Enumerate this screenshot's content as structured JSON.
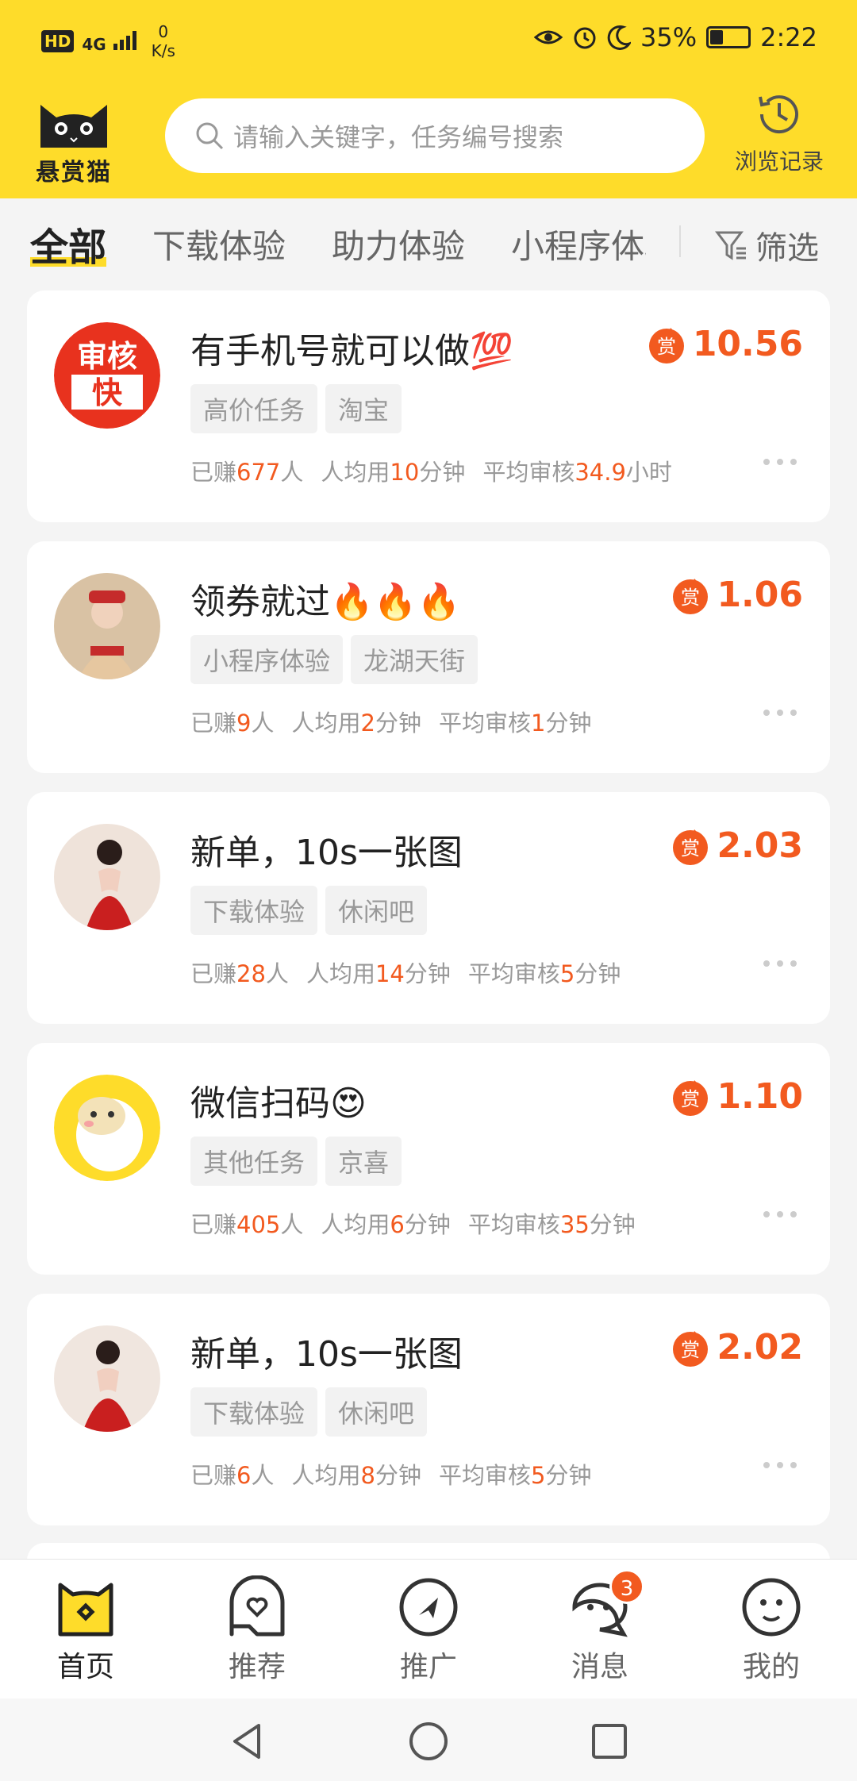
{
  "status_bar": {
    "hd": "HD",
    "network": "4G",
    "speed_value": "0",
    "speed_unit": "K/s",
    "battery": "35%",
    "battery_level": 0.35,
    "time": "2:22",
    "icons": [
      "eye-icon",
      "alarm-icon",
      "moon-icon",
      "battery-icon"
    ]
  },
  "header": {
    "logo_text": "悬赏猫",
    "search_placeholder": "请输入关键字，任务编号搜索",
    "history_label": "浏览记录",
    "accent": "#fedc2a"
  },
  "tabs": {
    "items": [
      "全部",
      "下载体验",
      "助力体验",
      "小程序体验"
    ],
    "active": 0,
    "filter_label": "筛选"
  },
  "stat_labels": {
    "earned_prefix": "已赚",
    "earned_suffix": "人",
    "avg_prefix": "人均用",
    "review_prefix": "平均审核"
  },
  "tasks": [
    {
      "title": "有手机号就可以做💯",
      "tags": [
        "高价任务",
        "淘宝"
      ],
      "reward": "10.56",
      "earned": "677",
      "avg_time": "10",
      "avg_unit": "分钟",
      "review_time": "34.9",
      "review_unit": "小时",
      "avatar_text_top": "审核",
      "avatar_text_bottom": "快"
    },
    {
      "title": "领券就过🔥🔥🔥",
      "tags": [
        "小程序体验",
        "龙湖天街"
      ],
      "reward": "1.06",
      "earned": "9",
      "avg_time": "2",
      "avg_unit": "分钟",
      "review_time": "1",
      "review_unit": "分钟"
    },
    {
      "title": "新单，10s一张图",
      "tags": [
        "下载体验",
        "休闲吧"
      ],
      "reward": "2.03",
      "earned": "28",
      "avg_time": "14",
      "avg_unit": "分钟",
      "review_time": "5",
      "review_unit": "分钟"
    },
    {
      "title": "微信扫码😍",
      "tags": [
        "其他任务",
        "京喜"
      ],
      "reward": "1.10",
      "earned": "405",
      "avg_time": "6",
      "avg_unit": "分钟",
      "review_time": "35",
      "review_unit": "分钟"
    },
    {
      "title": "新单，10s一张图",
      "tags": [
        "下载体验",
        "休闲吧"
      ],
      "reward": "2.02",
      "earned": "6",
      "avg_time": "8",
      "avg_unit": "分钟",
      "review_time": "5",
      "review_unit": "分钟"
    }
  ],
  "reward_badge": "赏",
  "bottom_nav": {
    "items": [
      "首页",
      "推荐",
      "推广",
      "消息",
      "我的"
    ],
    "active": 0,
    "message_badge": "3"
  },
  "colors": {
    "accent": "#fedc2a",
    "price": "#f25a1f"
  }
}
